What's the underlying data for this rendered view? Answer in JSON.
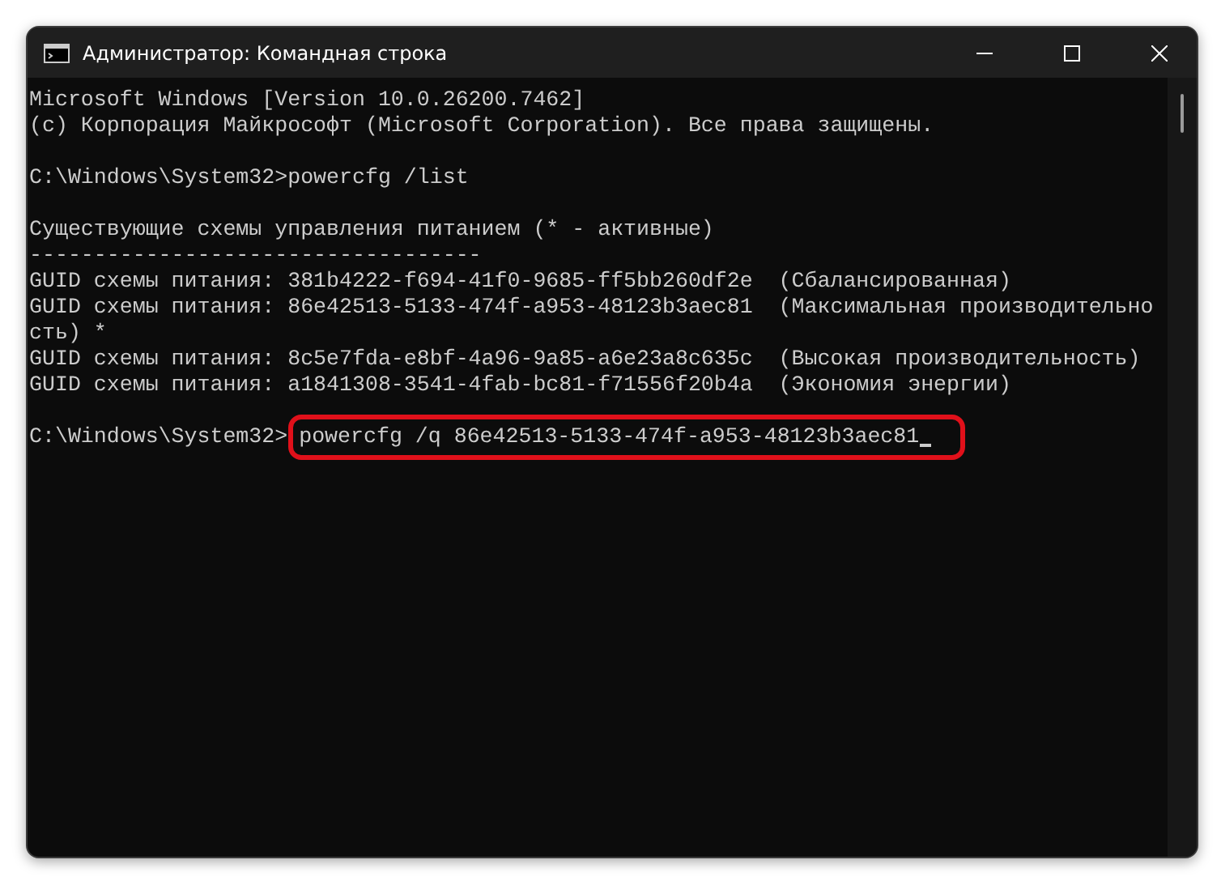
{
  "window": {
    "title": "Администратор: Командная строка"
  },
  "console": {
    "blocks": [
      [
        "Microsoft Windows [Version 10.0.26200.7462]",
        "(c) Корпорация Майкрософт (Microsoft Corporation). Все права защищены."
      ],
      [
        "C:\\Windows\\System32>powercfg /list"
      ],
      [
        "Существующие схемы управления питанием (* - активные)",
        "-----------------------------------",
        "GUID схемы питания: 381b4222-f694-41f0-9685-ff5bb260df2e  (Сбалансированная)",
        "GUID схемы питания: 86e42513-5133-474f-a953-48123b3aec81  (Максимальная производительно",
        "сть) *",
        "GUID схемы питания: 8c5e7fda-e8bf-4a96-9a85-a6e23a8c635c  (Высокая производительность)",
        "GUID схемы питания: a1841308-3541-4fab-bc81-f71556f20b4a  (Экономия энергии)"
      ]
    ],
    "prompt": "C:\\Windows\\System32>",
    "command": {
      "text": "powercfg /q 86e42513-5133-474f-a953-48123b3aec81",
      "highlighted": true
    }
  }
}
